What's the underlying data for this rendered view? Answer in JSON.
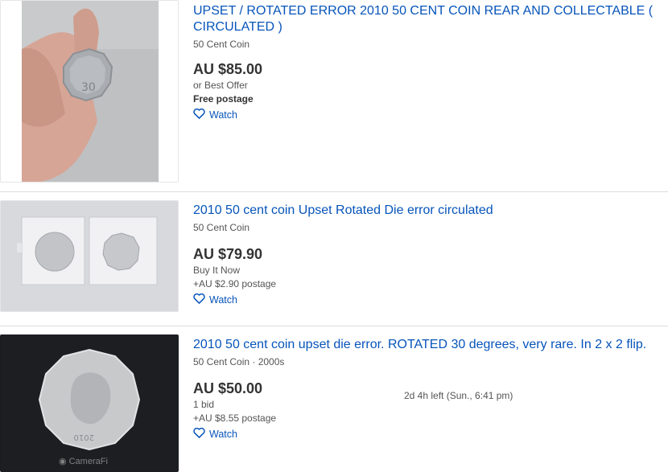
{
  "listings": [
    {
      "title": "UPSET / ROTATED ERROR 2010 50 CENT COIN REAR AND COLLECTABLE ( CIRCULATED )",
      "subtitle": "50 Cent Coin",
      "price": "AU $85.00",
      "line1": "or Best Offer",
      "line2": "Free postage",
      "watch": "Watch",
      "image_icon": "coin-photo-hand"
    },
    {
      "title": "2010 50 cent coin Upset Rotated Die error circulated",
      "subtitle": "50 Cent Coin",
      "price": "AU $79.90",
      "line1": "Buy It Now",
      "line2": "+AU $2.90 postage",
      "watch": "Watch",
      "image_icon": "coin-photo-flips"
    },
    {
      "title": "2010 50 cent coin upset die error. ROTATED 30 degrees, very rare. In 2 x 2 flip.",
      "subtitle": "50 Cent Coin · 2000s",
      "price": "AU $50.00",
      "line1": "1 bid",
      "line2": "+AU $8.55 postage",
      "time_left": "2d 4h left (Sun., 6:41 pm)",
      "watch": "Watch",
      "watermark": "CameraFi",
      "image_icon": "coin-photo-dark"
    }
  ],
  "colors": {
    "link": "#0654ba",
    "text": "#333333",
    "muted": "#555555"
  }
}
